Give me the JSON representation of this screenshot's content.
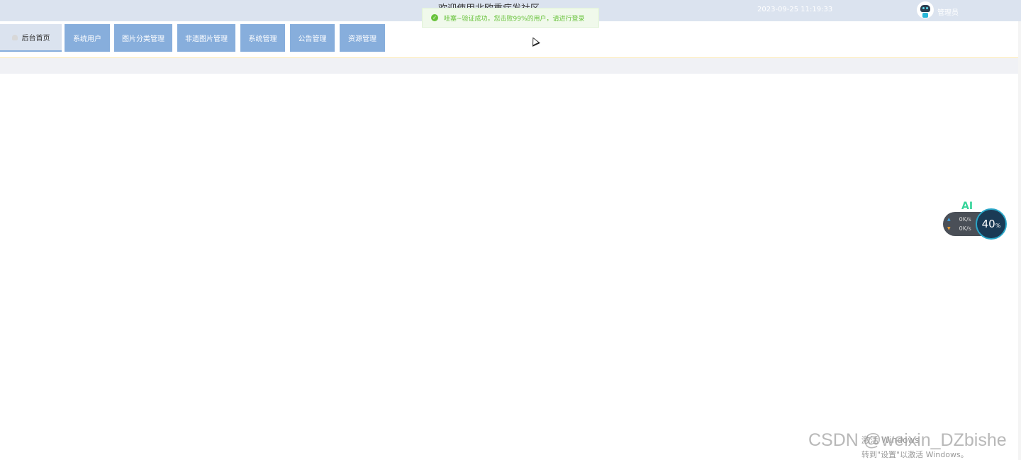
{
  "header": {
    "title": "欢迎使用北欧重症发社区",
    "datetime": "2023-09-25 11:19:33",
    "admin_name": "管理员"
  },
  "toast": {
    "message": "哇塞~验证成功，您击败99%的用户，请进行登录"
  },
  "nav": {
    "items": [
      {
        "label": "后台首页"
      },
      {
        "label": "系统用户"
      },
      {
        "label": "图片分类管理"
      },
      {
        "label": "非遗图片管理"
      },
      {
        "label": "系统管理"
      },
      {
        "label": "公告管理"
      },
      {
        "label": "资源管理"
      }
    ]
  },
  "net_widget": {
    "ai": "AI",
    "upload": "0K/s",
    "download": "0K/s",
    "percent": "40",
    "percent_sign": "%"
  },
  "watermarks": {
    "windows_line1": "激活 Windows",
    "windows_line2": "转到\"设置\"以激活 Windows。",
    "csdn": "CSDN @weixin_DZbishe"
  },
  "colors": {
    "topbar": "#dbe3ef",
    "nav_button": "#87aedc",
    "toast_bg": "#f0f9eb",
    "toast_text": "#67c23a"
  }
}
